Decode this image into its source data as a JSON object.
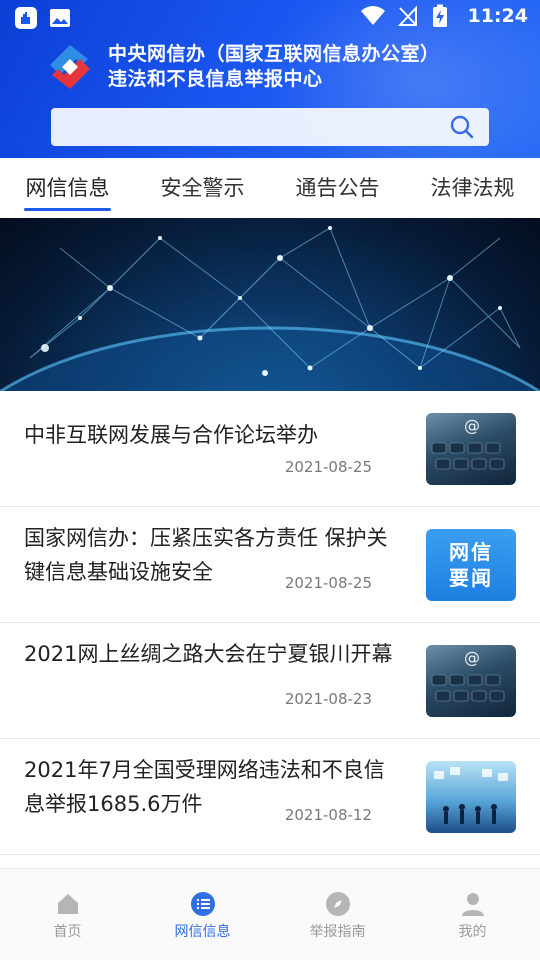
{
  "status_bar": {
    "time": "11:24",
    "icons": [
      "app-notification-icon",
      "image-notification-icon",
      "wifi-icon",
      "no-signal-icon",
      "battery-charging-icon"
    ]
  },
  "header": {
    "title_line1": "中央网信办（国家互联网信息办公室）",
    "title_line2": "违法和不良信息举报中心",
    "search_placeholder": "",
    "colors": {
      "primary": "#1a56f0",
      "logo_red": "#e8343b",
      "logo_blue": "#2f8de6"
    }
  },
  "tabs": [
    {
      "label": "网信信息",
      "active": true
    },
    {
      "label": "安全警示",
      "active": false
    },
    {
      "label": "通告公告",
      "active": false
    },
    {
      "label": "法律法规",
      "active": false
    }
  ],
  "news": [
    {
      "title": "中非互联网发展与合作论坛举办",
      "date": "2021-08-25",
      "thumb": "keyboard-image"
    },
    {
      "title": "国家网信办：压紧压实各方责任 保护关键信息基础设施安全",
      "date": "2021-08-25",
      "thumb": "news-badge",
      "thumb_text_1": "网信",
      "thumb_text_2": "要闻"
    },
    {
      "title": "2021网上丝绸之路大会在宁夏银川开幕",
      "date": "2021-08-23",
      "thumb": "keyboard-image"
    },
    {
      "title": "2021年7月全国受理网络违法和不良信息举报1685.6万件",
      "date": "2021-08-12",
      "thumb": "people-image"
    }
  ],
  "bottom_nav": [
    {
      "label": "首页",
      "icon": "home-icon",
      "active": false
    },
    {
      "label": "网信信息",
      "icon": "list-icon",
      "active": true
    },
    {
      "label": "举报指南",
      "icon": "compass-icon",
      "active": false
    },
    {
      "label": "我的",
      "icon": "person-icon",
      "active": false
    }
  ],
  "accent_color": "#2f6fe6"
}
